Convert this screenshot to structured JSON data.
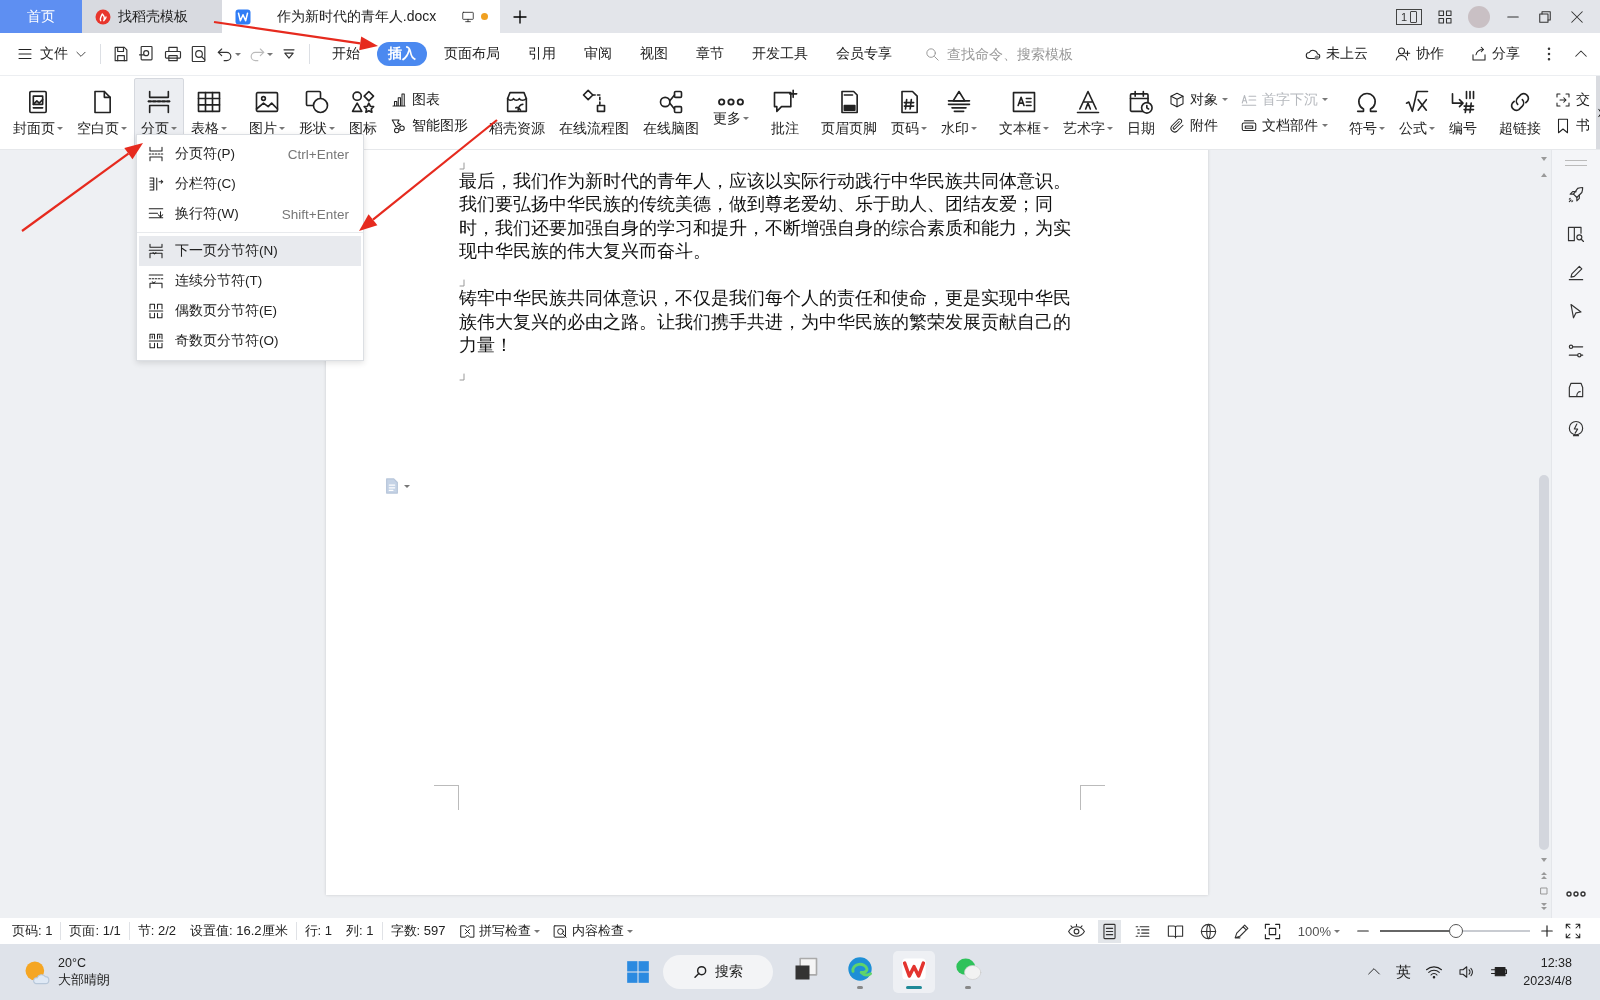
{
  "tabs": [
    {
      "kind": "home",
      "label": "首页",
      "selected": false,
      "modified": false
    },
    {
      "kind": "template",
      "label": "找稻壳模板",
      "selected": false,
      "modified": false
    },
    {
      "kind": "document",
      "label": "作为新时代的青年人.docx",
      "selected": true,
      "modified": true
    }
  ],
  "title_bar": {
    "screen_badge": "1"
  },
  "menu_bar": {
    "file_menu": "文件",
    "quick_access": [
      {
        "disabled": false
      },
      {
        "disabled": false
      },
      {
        "disabled": false
      },
      {
        "disabled": false
      },
      {
        "disabled": false
      },
      {
        "disabled": true
      },
      {
        "disabled": false
      }
    ],
    "tabs": [
      {
        "label": "开始",
        "selected": false
      },
      {
        "label": "插入",
        "selected": true
      },
      {
        "label": "页面布局",
        "selected": false
      },
      {
        "label": "引用",
        "selected": false
      },
      {
        "label": "审阅",
        "selected": false
      },
      {
        "label": "视图",
        "selected": false
      },
      {
        "label": "章节",
        "selected": false
      },
      {
        "label": "开发工具",
        "selected": false
      },
      {
        "label": "会员专享",
        "selected": false
      }
    ],
    "search": {
      "placeholder": "查找命令、搜索模板"
    },
    "actions": [
      {
        "label": "未上云"
      },
      {
        "label": "协作"
      },
      {
        "label": "分享"
      }
    ]
  },
  "ribbon": [
    {
      "items": [
        {
          "kind": "large",
          "label": "封面页",
          "dropdown": true,
          "expanded": false
        },
        {
          "kind": "large",
          "label": "空白页",
          "dropdown": true,
          "expanded": false
        },
        {
          "kind": "large",
          "label": "分页",
          "dropdown": true,
          "expanded": true
        },
        {
          "kind": "large",
          "label": "表格",
          "dropdown": true,
          "expanded": false
        }
      ]
    },
    {
      "items": [
        {
          "kind": "large",
          "label": "图片",
          "dropdown": true,
          "expanded": false
        },
        {
          "kind": "large",
          "label": "形状",
          "dropdown": true,
          "expanded": false
        },
        {
          "kind": "large",
          "label": "图标",
          "dropdown": false,
          "expanded": false
        },
        {
          "kind": "stack",
          "items": [
            {
              "label": "图表",
              "dropdown": false,
              "disabled": false
            },
            {
              "label": "智能图形",
              "dropdown": false,
              "disabled": false
            }
          ]
        }
      ]
    },
    {
      "items": [
        {
          "kind": "large",
          "label": "稻壳资源",
          "dropdown": false,
          "expanded": false
        },
        {
          "kind": "large",
          "label": "在线流程图",
          "dropdown": false,
          "expanded": false
        },
        {
          "kind": "large",
          "label": "在线脑图",
          "dropdown": false,
          "expanded": false
        },
        {
          "kind": "large",
          "label": "更多",
          "dropdown": true,
          "expanded": false
        }
      ]
    },
    {
      "items": [
        {
          "kind": "large",
          "label": "批注",
          "dropdown": false,
          "expanded": false
        }
      ]
    },
    {
      "items": [
        {
          "kind": "large",
          "label": "页眉页脚",
          "dropdown": false,
          "expanded": false
        },
        {
          "kind": "large",
          "label": "页码",
          "dropdown": true,
          "expanded": false
        },
        {
          "kind": "large",
          "label": "水印",
          "dropdown": true,
          "expanded": false
        }
      ]
    },
    {
      "items": [
        {
          "kind": "large",
          "label": "文本框",
          "dropdown": true,
          "expanded": false
        },
        {
          "kind": "large",
          "label": "艺术字",
          "dropdown": true,
          "expanded": false
        },
        {
          "kind": "large",
          "label": "日期",
          "dropdown": false,
          "expanded": false
        },
        {
          "kind": "stack",
          "items": [
            {
              "label": "对象",
              "dropdown": true,
              "disabled": false
            },
            {
              "label": "附件",
              "dropdown": false,
              "disabled": false
            }
          ]
        },
        {
          "kind": "stack",
          "items": [
            {
              "label": "首字下沉",
              "dropdown": true,
              "disabled": true
            },
            {
              "label": "文档部件",
              "dropdown": true,
              "disabled": false
            }
          ]
        }
      ]
    },
    {
      "items": [
        {
          "kind": "large",
          "label": "符号",
          "dropdown": true,
          "expanded": false
        },
        {
          "kind": "large",
          "label": "公式",
          "dropdown": true,
          "expanded": false
        },
        {
          "kind": "large",
          "label": "编号",
          "dropdown": false,
          "expanded": false
        }
      ]
    },
    {
      "items": [
        {
          "kind": "large",
          "label": "超链接",
          "dropdown": false,
          "expanded": false
        },
        {
          "kind": "stack",
          "items": [
            {
              "label": "交",
              "dropdown": false,
              "disabled": false
            },
            {
              "label": "书",
              "dropdown": false,
              "disabled": false
            }
          ]
        }
      ]
    }
  ],
  "dropdown_menu": {
    "sections": [
      [
        {
          "label": "分页符(P)",
          "shortcut": "Ctrl+Enter",
          "selected": false
        },
        {
          "label": "分栏符(C)",
          "selected": false
        },
        {
          "label": "换行符(W)",
          "shortcut": "Shift+Enter",
          "selected": false
        }
      ],
      [
        {
          "label": "下一页分节符(N)",
          "selected": true
        },
        {
          "label": "连续分节符(T)",
          "selected": false
        },
        {
          "label": "偶数页分节符(E)",
          "selected": false
        },
        {
          "label": "奇数页分节符(O)",
          "selected": false
        }
      ]
    ]
  },
  "document": {
    "paragraphs": [
      {
        "kind": "empty"
      },
      {
        "kind": "text",
        "text": "最后，我们作为新时代的青年人，应该以实际行动践行中华民族共同体意识。我们要弘扬中华民族的传统美德，做到尊老爱幼、乐于助人、团结友爱；同时，我们还要加强自身的学习和提升，不断增强自身的综合素质和能力，为实现中华民族的伟大复兴而奋斗。"
      },
      {
        "kind": "empty"
      },
      {
        "kind": "text",
        "text": "铸牢中华民族共同体意识，不仅是我们每个人的责任和使命，更是实现中华民族伟大复兴的必由之路。让我们携手共进，为中华民族的繁荣发展贡献自己的力量！"
      },
      {
        "kind": "empty"
      }
    ]
  },
  "status_bar": {
    "groups": [
      [
        "页码: 1"
      ],
      [
        "页面: 1/1"
      ],
      [
        "节: 2/2",
        "设置值: 16.2厘米"
      ],
      [
        "行: 1",
        "列: 1"
      ],
      [
        "字数: 597"
      ]
    ],
    "checks": [
      {
        "label": "拼写检查"
      },
      {
        "label": "内容检查"
      }
    ],
    "view_modes": [
      {
        "selected": false
      },
      {
        "selected": true
      },
      {
        "selected": false
      },
      {
        "selected": false
      },
      {
        "selected": false
      },
      {
        "selected": false
      }
    ],
    "zoom": {
      "reading": "100%",
      "level": 0.5
    }
  },
  "taskbar": {
    "weather": {
      "temperature": "20°C",
      "condition": "大部晴朗"
    },
    "search": {
      "label": "搜索"
    },
    "apps": [
      {
        "running": false,
        "selected": false
      },
      {
        "running": true,
        "selected": false
      },
      {
        "running": true,
        "selected": true
      },
      {
        "running": true,
        "selected": false
      }
    ],
    "input_method": "英",
    "time": "12:38",
    "date": "2023/4/8"
  }
}
